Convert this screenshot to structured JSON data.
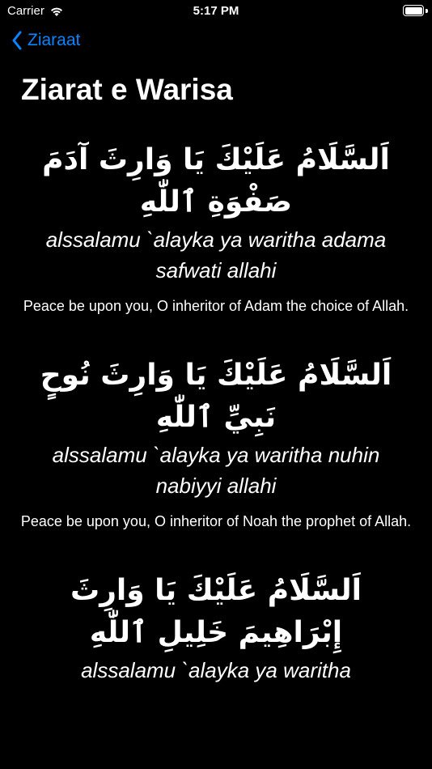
{
  "status_bar": {
    "carrier": "Carrier",
    "time": "5:17 PM",
    "wifi_icon": "wifi-icon",
    "battery_icon": "battery-icon"
  },
  "nav": {
    "back_label": "Ziaraat",
    "back_icon": "chevron-left-icon",
    "accent_color": "#0a84ff"
  },
  "page": {
    "title": "Ziarat e Warisa"
  },
  "verses": [
    {
      "arabic": "اَلسَّلَامُ عَلَيْكَ يَا وَارِثَ آدَمَ صَفْوَةِ ٱللّٰهِ",
      "transliteration": "alssalamu `alayka ya waritha adama safwati allahi",
      "translation": "Peace be upon you, O inheritor of Adam the choice of Allah."
    },
    {
      "arabic": "اَلسَّلَامُ عَلَيْكَ يَا وَارِثَ نُوحٍ نَبِيِّ ٱللّٰهِ",
      "transliteration": "alssalamu `alayka ya waritha nuhin nabiyyi allahi",
      "translation": "Peace be upon you, O inheritor of Noah the prophet of Allah."
    },
    {
      "arabic": "اَلسَّلَامُ عَلَيْكَ يَا وَارِثَ إِبْرَاهِيمَ خَلِيلِ ٱللّٰهِ",
      "transliteration": "alssalamu `alayka ya waritha"
    }
  ]
}
